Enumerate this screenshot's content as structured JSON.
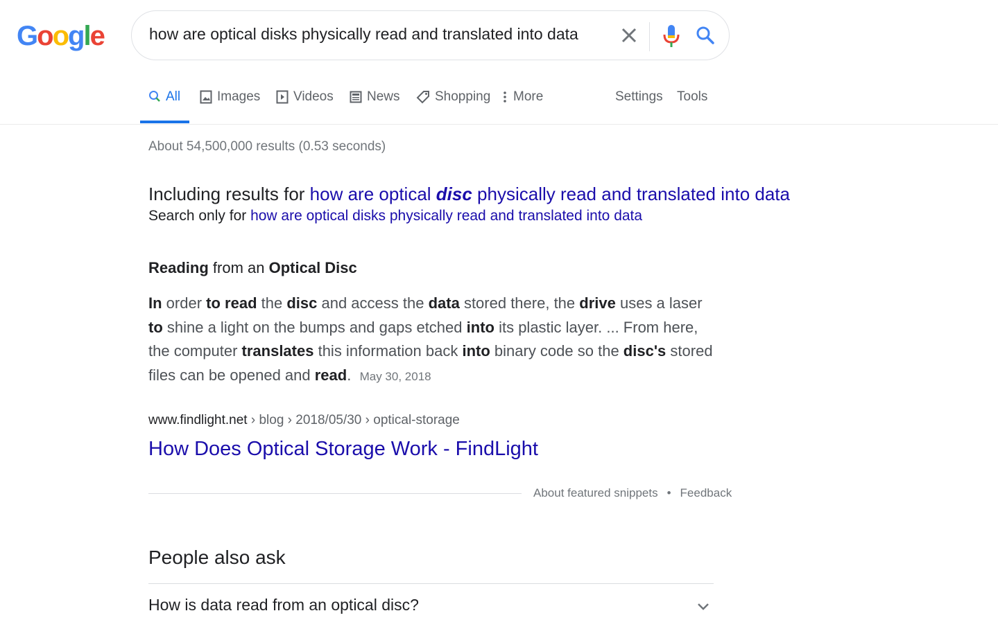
{
  "logo": {
    "letters": [
      "G",
      "o",
      "o",
      "g",
      "l",
      "e"
    ],
    "colors": [
      "#4285f4",
      "#ea4335",
      "#fbbc05",
      "#4285f4",
      "#34a853",
      "#ea4335"
    ]
  },
  "search": {
    "query": "how are optical disks physically read and translated into data"
  },
  "tabs": [
    {
      "label": "All",
      "icon": "search-icon",
      "active": true
    },
    {
      "label": "Images",
      "icon": "image-icon",
      "active": false
    },
    {
      "label": "Videos",
      "icon": "video-icon",
      "active": false
    },
    {
      "label": "News",
      "icon": "news-icon",
      "active": false
    },
    {
      "label": "Shopping",
      "icon": "tag-icon",
      "active": false
    },
    {
      "label": "More",
      "icon": "more-vert-icon",
      "active": false
    }
  ],
  "tools": {
    "settings": "Settings",
    "tools": "Tools"
  },
  "stats": "About 54,500,000 results (0.53 seconds)",
  "correction": {
    "including_prefix": "Including results for ",
    "corrected_part1": "how are optical ",
    "corrected_bold": "disc",
    "corrected_part2": " physically read and translated into data",
    "only_prefix": "Search only for ",
    "original": "how are optical disks physically read and translated into data"
  },
  "snippet": {
    "title_bold1": "Reading",
    "title_mid": " from an ",
    "title_bold2": "Optical Disc",
    "t1": "In",
    "t2": " order ",
    "t3": "to read",
    "t4": " the ",
    "t5": "disc",
    "t6": " and access the ",
    "t7": "data",
    "t8": " stored there, the ",
    "t9": "drive",
    "t10": " uses a laser ",
    "t11": "to",
    "t12": " shine a light on the bumps and gaps etched ",
    "t13": "into",
    "t14": " its plastic layer. ... From here, the computer ",
    "t15": "translates",
    "t16": " this information back ",
    "t17": "into",
    "t18": " binary code so the ",
    "t19": "disc's",
    "t20": " stored files can be opened and ",
    "t21": "read",
    "t22": ".",
    "date": "May 30, 2018"
  },
  "result": {
    "domain": "www.findlight.net",
    "path": " › blog › 2018/05/30 › optical-storage",
    "title": "How Does Optical Storage Work - FindLight"
  },
  "footer": {
    "about": "About featured snippets",
    "dot": "•",
    "feedback": "Feedback"
  },
  "paa": {
    "title": "People also ask",
    "questions": [
      "How is data read from an optical disc?"
    ]
  },
  "colors": {
    "link": "#1a0dab",
    "accent": "#1a73e8",
    "muted": "#70757a"
  }
}
